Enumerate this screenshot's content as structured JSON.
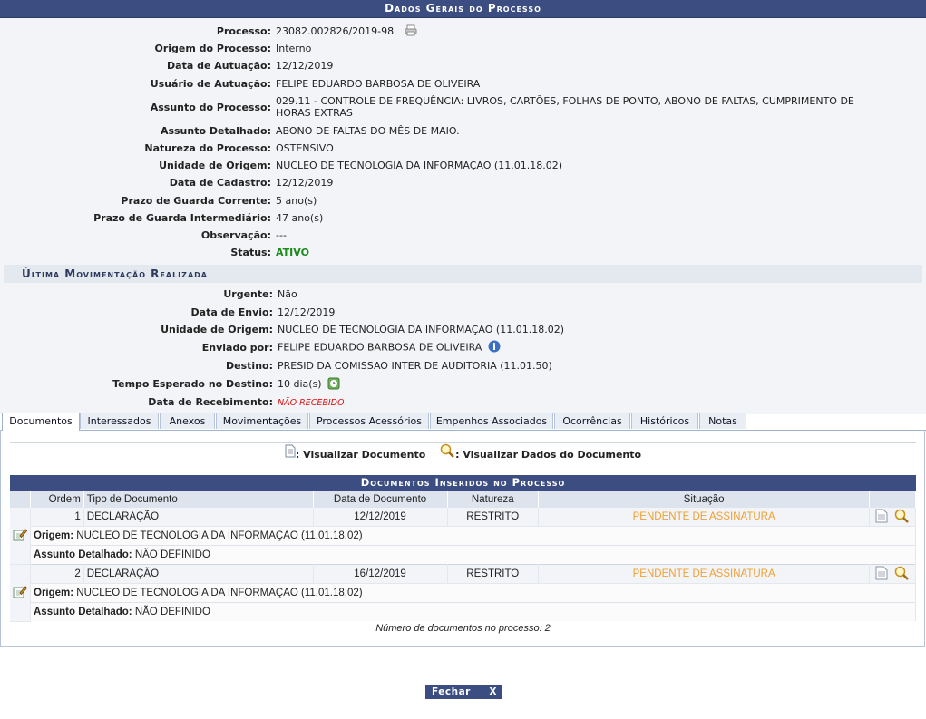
{
  "header": {
    "title": "Dados Gerais do Processo"
  },
  "geral": [
    {
      "label": "Processo:",
      "value": "23082.002826/2019-98"
    },
    {
      "label": "Origem do Processo:",
      "value": "Interno"
    },
    {
      "label": "Data de Autuação:",
      "value": "12/12/2019"
    },
    {
      "label": "Usuário de Autuação:",
      "value": "FELIPE EDUARDO BARBOSA DE OLIVEIRA"
    },
    {
      "label": "Assunto do Processo:",
      "value": "029.11 - CONTROLE DE FREQUÊNCIA: LIVROS, CARTÕES, FOLHAS DE PONTO, ABONO DE FALTAS, CUMPRIMENTO DE HORAS EXTRAS"
    },
    {
      "label": "Assunto Detalhado:",
      "value": "ABONO DE FALTAS DO MÊS DE MAIO."
    },
    {
      "label": "Natureza do Processo:",
      "value": "OSTENSIVO"
    },
    {
      "label": "Unidade de Origem:",
      "value": "NUCLEO DE TECNOLOGIA DA INFORMAÇAO (11.01.18.02)"
    },
    {
      "label": "Data de Cadastro:",
      "value": "12/12/2019"
    },
    {
      "label": "Prazo de Guarda Corrente:",
      "value": "5 ano(s)"
    },
    {
      "label": "Prazo de Guarda Intermediário:",
      "value": "47 ano(s)"
    },
    {
      "label": "Observação:",
      "value": "---"
    },
    {
      "label": "Status:",
      "value": "ATIVO"
    }
  ],
  "movimentacao": {
    "title": "Última Movimentação Realizada",
    "rows": [
      {
        "label": "Urgente:",
        "value": "Não"
      },
      {
        "label": "Data de Envio:",
        "value": "12/12/2019"
      },
      {
        "label": "Unidade de Origem:",
        "value": "NUCLEO DE TECNOLOGIA DA INFORMAÇAO (11.01.18.02)"
      },
      {
        "label": "Enviado por:",
        "value": "FELIPE EDUARDO BARBOSA DE OLIVEIRA"
      },
      {
        "label": "Destino:",
        "value": "PRESID DA COMISSAO INTER DE AUDITORIA (11.01.50)"
      },
      {
        "label": "Tempo Esperado no Destino:",
        "value": "10 dia(s)"
      },
      {
        "label": "Data de Recebimento:",
        "value": "NÃO RECEBIDO"
      }
    ]
  },
  "tabs": [
    "Documentos",
    "Interessados",
    "Anexos",
    "Movimentações",
    "Processos Acessórios",
    "Empenhos Associados",
    "Ocorrências",
    "Históricos",
    "Notas"
  ],
  "legend": {
    "view_doc": ": Visualizar Documento",
    "view_data": ": Visualizar Dados do Documento"
  },
  "docs": {
    "title": "Documentos Inseridos no Processo",
    "columns": [
      "Ordem",
      "Tipo de Documento",
      "Data de Documento",
      "Natureza",
      "Situação"
    ],
    "rows": [
      {
        "ordem": "1",
        "tipo": "DECLARAÇÃO",
        "data": "12/12/2019",
        "natureza": "RESTRITO",
        "situacao": "PENDENTE DE ASSINATURA",
        "origem_label": "Origem:",
        "origem": "NUCLEO DE TECNOLOGIA DA INFORMAÇAO (11.01.18.02)",
        "assunto_label": "Assunto Detalhado:",
        "assunto": "NÃO DEFINIDO"
      },
      {
        "ordem": "2",
        "tipo": "DECLARAÇÃO",
        "data": "16/12/2019",
        "natureza": "RESTRITO",
        "situacao": "PENDENTE DE ASSINATURA",
        "origem_label": "Origem:",
        "origem": "NUCLEO DE TECNOLOGIA DA INFORMAÇAO (11.01.18.02)",
        "assunto_label": "Assunto Detalhado:",
        "assunto": "NÃO DEFINIDO"
      }
    ],
    "count": "Número de documentos no processo: 2"
  },
  "buttons": {
    "close": "Fechar",
    "close_x": "X"
  },
  "colors": {
    "header": "#3c4d82",
    "status": "#1a8a1a",
    "pending": "#f0a030",
    "not_received": "#dd1111"
  }
}
